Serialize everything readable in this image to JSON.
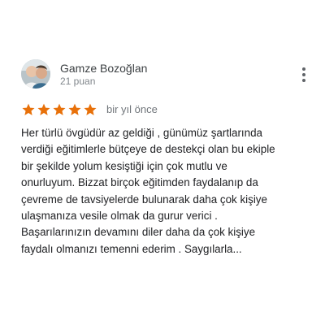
{
  "reviewer": {
    "name": "Gamze Bozoğlan",
    "points": "21 puan",
    "avatar_icon": "profile-photo"
  },
  "more_menu": {
    "icon": "more-vert-icon"
  },
  "rating": {
    "stars": 5,
    "max_stars": 5,
    "star_color": "#e8710a",
    "date": "bir yıl önce"
  },
  "review": {
    "lines": [
      "Her türlü övgüdür az geldiği , günümüz şartlarında",
      "verdiği eğitimlerle bütçeye de destekçi olan bu ekiple",
      "bir şekilde yolum kesiştiği için çok mutlu ve",
      "onurluyum. Bizzat birçok eğitimden faydalanıp da",
      "çevreme de tavsiyelerde bulunarak daha çok kişiye",
      "ulaşmanıza vesile olmak da gurur verici .",
      "Başarılarınızın devamını diler daha da çok kişiye",
      "faydalı olmanızı temenni ederim . Saygılarla..."
    ]
  }
}
